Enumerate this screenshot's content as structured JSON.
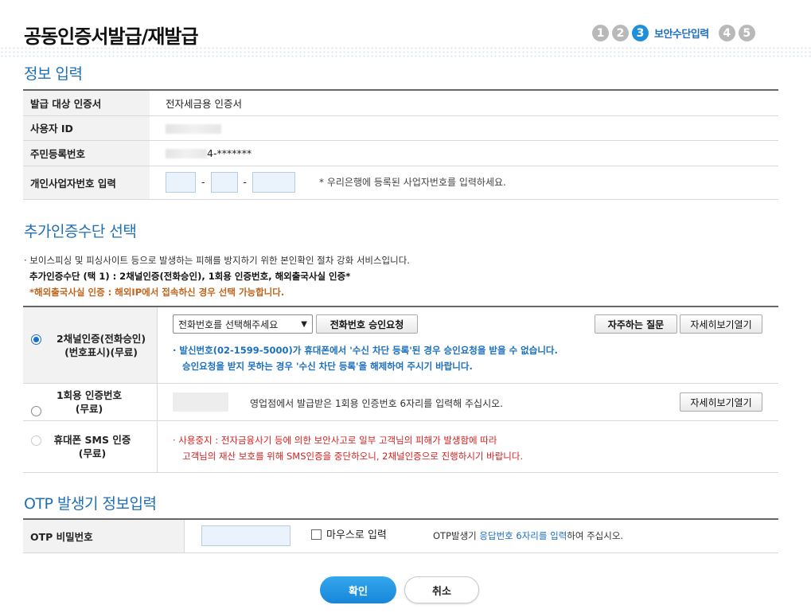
{
  "header": {
    "title": "공동인증서발급/재발급",
    "steps": [
      {
        "num": "1"
      },
      {
        "num": "2"
      },
      {
        "num": "3",
        "label": "보안수단입력"
      },
      {
        "num": "4"
      },
      {
        "num": "5"
      }
    ]
  },
  "info": {
    "title": "정보 입력",
    "rows": {
      "cert_label": "발급 대상 인증서",
      "cert_value": "전자세금용 인증서",
      "user_label": "사용자 ID",
      "rrn_label": "주민등록번호",
      "rrn_suffix": "4-*******",
      "biz_label": "개인사업자번호 입력",
      "dash": "-",
      "biz_note": "* 우리은행에 등록된 사업자번호를 입력하세요."
    }
  },
  "extra": {
    "title": "추가인증수단 선택",
    "desc1": "· 보이스피싱 및 피싱사이트 등으로 발생하는 피해를 방지하기 위한 본인확인 절차 강화 서비스입니다.",
    "desc2": "추가인증수단 (택 1) : 2채널인증(전화승인), 1회용 인증번호, 해외출국사실 인증*",
    "desc3": "*해외출국사실 인증 : 해외IP에서 접속하신 경우 선택 가능합니다.",
    "desc3_color": "#c0641c",
    "opt1": {
      "label1": "2채널인증(전화승인)",
      "label2": "(번호표시)(무료)",
      "select_value": "전화번호를 선택해주세요",
      "approve_btn": "전화번호 승인요청",
      "faq_btn": "자주하는 질문",
      "detail_btn": "자세히보기열기",
      "info1": "· 발신번호(02-1599-5000)가 휴대폰에서 '수신 차단 등록'된 경우 승인요청을 받을 수 없습니다.",
      "info2": "승인요청을 받지 못하는 경우 '수신 차단 등록'을 해제하여 주시기 바랍니다."
    },
    "opt2": {
      "label1": "1회용 인증번호",
      "label2": "(무료)",
      "info": "영업점에서 발급받은 1회용 인증번호 6자리를 입력해 주십시오.",
      "detail_btn": "자세히보기열기"
    },
    "opt3": {
      "label1": "휴대폰 SMS 인증",
      "label2": "(무료)",
      "info1": "· 사용중지 : 전자금융사기 등에 의한 보안사고로 일부 고객님의 피해가 발생함에 따라",
      "info2": "고객님의 재산 보호를 위해 SMS인증을 중단하오니, 2채널인증으로 진행하시기 바랍니다."
    }
  },
  "otp": {
    "title": "OTP 발생기 정보입력",
    "label": "OTP 비밀번호",
    "mouse_label": "마우스로 입력",
    "note_pre": "OTP발생기 ",
    "note_highlight": "응답번호 6자리를 입력",
    "note_post": "하여 주십시오."
  },
  "actions": {
    "confirm": "확인",
    "cancel": "취소"
  },
  "colors": {
    "accent": "#1f8fd8",
    "section_title": "#1f6fb5",
    "error": "#d42020"
  }
}
